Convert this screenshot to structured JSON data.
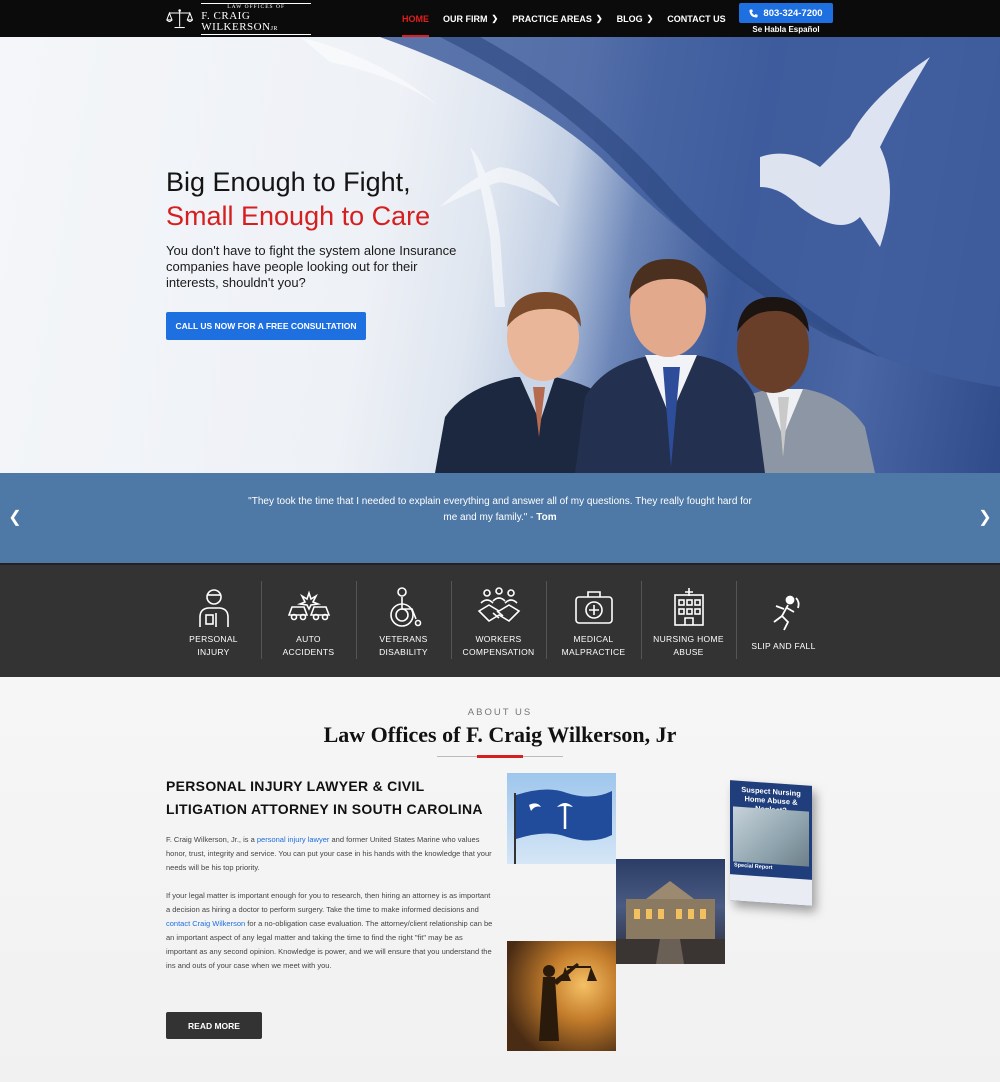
{
  "nav": {
    "logo_small": "LAW OFFICES OF",
    "logo_name": "F. CRAIG WILKERSON",
    "logo_suffix": "JR",
    "items": [
      {
        "label": "HOME",
        "active": true,
        "has_dropdown": false
      },
      {
        "label": "OUR FIRM",
        "active": false,
        "has_dropdown": true
      },
      {
        "label": "PRACTICE AREAS",
        "active": false,
        "has_dropdown": true
      },
      {
        "label": "BLOG",
        "active": false,
        "has_dropdown": true
      },
      {
        "label": "CONTACT US",
        "active": false,
        "has_dropdown": false
      }
    ],
    "phone": "803-324-7200",
    "phone_icon": "phone-icon",
    "espanol": "Se Habla Español"
  },
  "hero": {
    "title_line1": "Big Enough to Fight,",
    "title_line2": "Small Enough to Care",
    "subtitle": "You don't have to fight the system alone Insurance companies have people looking out for their interests, shouldn't you?",
    "cta_label": "CALL US NOW FOR A FREE CONSULTATION"
  },
  "testimonial": {
    "quote": "\"They took the time that I needed to explain everything and answer all of my questions. They really fought hard for me and my family.\" - ",
    "author": "Tom",
    "prev_icon": "chevron-left-icon",
    "next_icon": "chevron-right-icon"
  },
  "practice_areas": [
    {
      "line1": "PERSONAL",
      "line2": "INJURY",
      "icon": "injured-person-icon"
    },
    {
      "line1": "AUTO",
      "line2": "ACCIDENTS",
      "icon": "car-crash-icon"
    },
    {
      "line1": "VETERANS",
      "line2": "DISABILITY",
      "icon": "wheelchair-icon"
    },
    {
      "line1": "WORKERS",
      "line2": "COMPENSATION",
      "icon": "handshake-icon"
    },
    {
      "line1": "MEDICAL",
      "line2": "MALPRACTICE",
      "icon": "medical-kit-icon"
    },
    {
      "line1": "NURSING HOME",
      "line2": "ABUSE",
      "icon": "hospital-icon"
    },
    {
      "line1": "SLIP AND FALL",
      "line2": "",
      "icon": "slip-fall-icon"
    }
  ],
  "about": {
    "eyebrow": "ABOUT US",
    "title": "Law Offices of F. Craig Wilkerson, Jr",
    "heading": "PERSONAL INJURY LAWYER & CIVIL LITIGATION ATTORNEY IN SOUTH CAROLINA",
    "p1_a": "F. Craig Wilkerson, Jr., is a ",
    "p1_link": "personal injury lawyer",
    "p1_b": " and former United States Marine who values honor, trust, integrity and service. You can put your case in his hands with the knowledge that your needs will be his top priority.",
    "p2_a": "If your legal matter is important enough for you to research, then hiring an attorney is as important a decision as hiring a doctor to perform surgery. Take the time to make informed decisions and ",
    "p2_link": "contact Craig Wilkerson",
    "p2_b": " for a no-obligation case evaluation. The attorney/client relationship can be an important aspect of any legal matter and taking the time to find the right \"fit\" may be as important as any second opinion. Knowledge is power, and we will ensure that you understand the ins and outs of your case when we meet with you.",
    "read_more": "READ MORE",
    "book_title": "Suspect Nursing Home Abuse & Neglect?",
    "book_label": "Special Report"
  },
  "colors": {
    "nav_bg": "#0b0b0b",
    "accent_red": "#d61f1f",
    "button_blue": "#1e6fe0",
    "testimonial_bg": "#4e78a6",
    "areas_bg": "#333333"
  }
}
